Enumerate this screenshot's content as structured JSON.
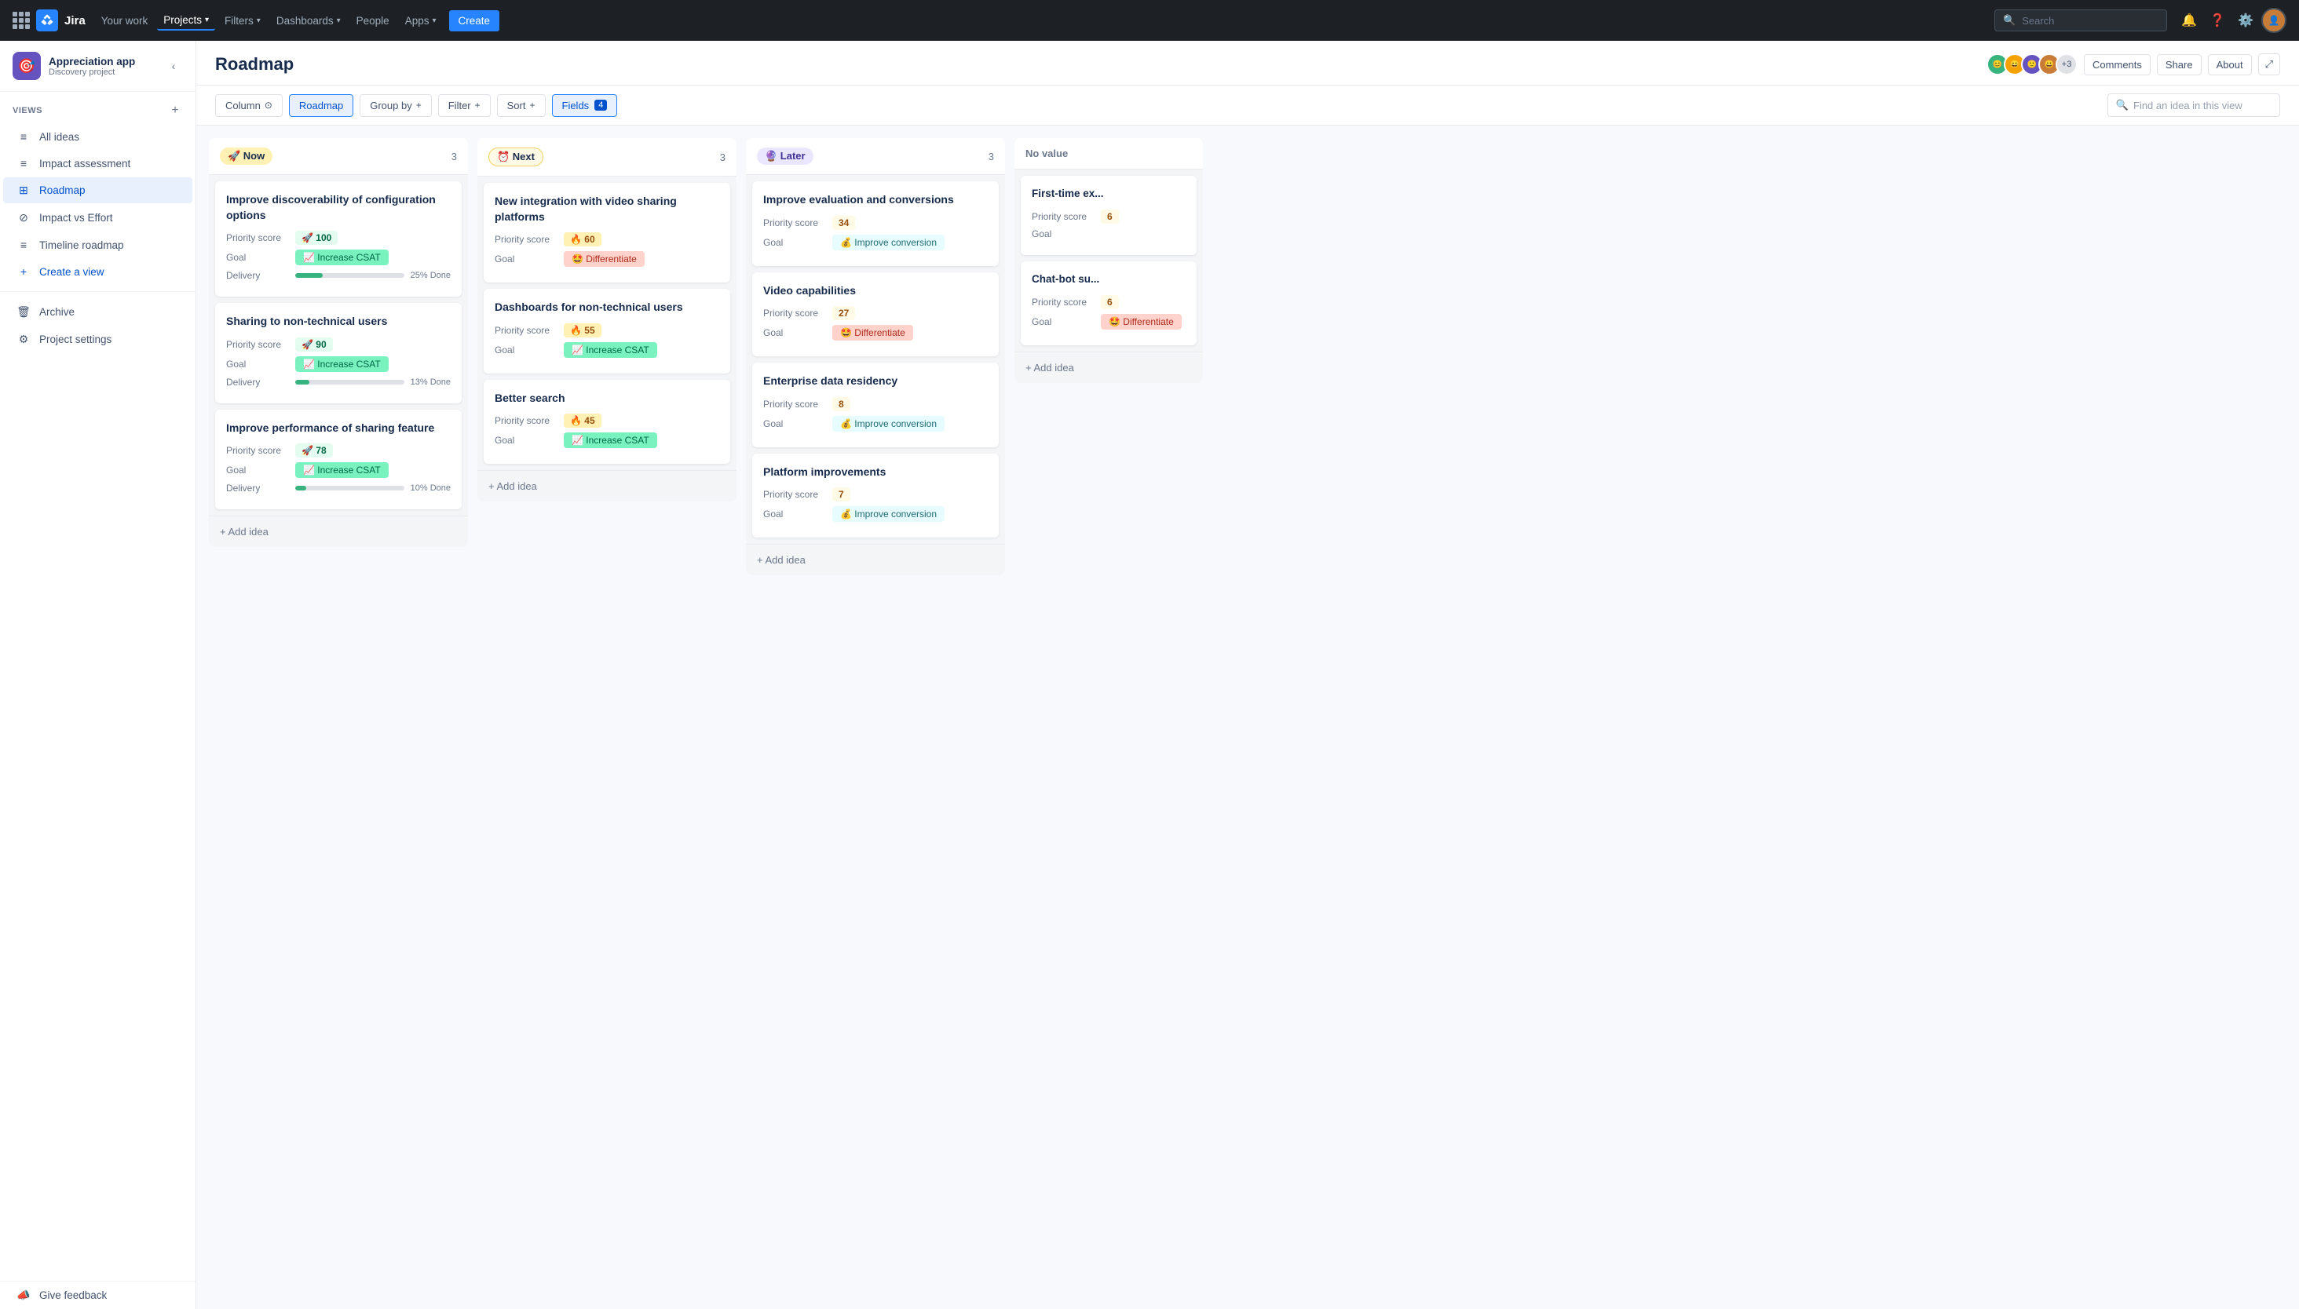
{
  "topnav": {
    "logo_text": "Jira",
    "your_work": "Your work",
    "projects": "Projects",
    "filters": "Filters",
    "dashboards": "Dashboards",
    "people": "People",
    "apps": "Apps",
    "create": "Create",
    "search_placeholder": "Search"
  },
  "sidebar": {
    "project_name": "Appreciation app",
    "project_type": "Discovery project",
    "project_emoji": "🎯",
    "views_label": "VIEWS",
    "items": [
      {
        "id": "all-ideas",
        "label": "All ideas",
        "icon": "≡"
      },
      {
        "id": "impact-assessment",
        "label": "Impact assessment",
        "icon": "≡"
      },
      {
        "id": "roadmap",
        "label": "Roadmap",
        "icon": "⊞",
        "active": true
      },
      {
        "id": "impact-vs-effort",
        "label": "Impact vs Effort",
        "icon": "⊘"
      },
      {
        "id": "timeline-roadmap",
        "label": "Timeline roadmap",
        "icon": "≡"
      },
      {
        "id": "create-view",
        "label": "Create a view",
        "icon": "+"
      }
    ],
    "archive": "Archive",
    "project_settings": "Project settings",
    "give_feedback": "Give feedback"
  },
  "page": {
    "title": "Roadmap",
    "header_btn_comments": "Comments",
    "header_btn_share": "Share",
    "header_btn_about": "About",
    "avatar_count": "+3"
  },
  "toolbar": {
    "column_label": "Column",
    "roadmap_label": "Roadmap",
    "group_by_label": "Group by",
    "filter_label": "Filter",
    "sort_label": "Sort",
    "fields_label": "Fields",
    "fields_count": "4",
    "search_placeholder": "Find an idea in this view"
  },
  "columns": [
    {
      "id": "now",
      "tag": "🚀 Now",
      "tag_class": "tag-now",
      "count": 3,
      "cards": [
        {
          "title": "Improve discoverability of configuration options",
          "priority_label": "Priority score",
          "priority_value": "100",
          "priority_emoji": "🚀",
          "priority_class": "score-green",
          "goal_label": "Goal",
          "goal_text": "Increase CSAT",
          "goal_emoji": "📈",
          "goal_class": "goal-csat",
          "has_delivery": true,
          "delivery_label": "Delivery",
          "delivery_pct": 25,
          "delivery_text": "25% Done"
        },
        {
          "title": "Sharing to non-technical users",
          "priority_label": "Priority score",
          "priority_value": "90",
          "priority_emoji": "🚀",
          "priority_class": "score-green",
          "goal_label": "Goal",
          "goal_text": "Increase CSAT",
          "goal_emoji": "📈",
          "goal_class": "goal-csat",
          "has_delivery": true,
          "delivery_label": "Delivery",
          "delivery_pct": 13,
          "delivery_text": "13% Done"
        },
        {
          "title": "Improve performance of sharing feature",
          "priority_label": "Priority score",
          "priority_value": "78",
          "priority_emoji": "🚀",
          "priority_class": "score-green",
          "goal_label": "Goal",
          "goal_text": "Increase CSAT",
          "goal_emoji": "📈",
          "goal_class": "goal-csat",
          "has_delivery": true,
          "delivery_label": "Delivery",
          "delivery_pct": 10,
          "delivery_text": "10% Done"
        }
      ],
      "add_idea": "+ Add idea"
    },
    {
      "id": "next",
      "tag": "⏰ Next",
      "tag_class": "tag-next",
      "count": 3,
      "cards": [
        {
          "title": "New integration with video sharing platforms",
          "priority_label": "Priority score",
          "priority_value": "60",
          "priority_emoji": "🔥",
          "priority_class": "score-orange",
          "goal_label": "Goal",
          "goal_text": "Differentiate",
          "goal_emoji": "🤩",
          "goal_class": "goal-differentiate",
          "has_delivery": false
        },
        {
          "title": "Dashboards for non-technical users",
          "priority_label": "Priority score",
          "priority_value": "55",
          "priority_emoji": "🔥",
          "priority_class": "score-orange",
          "goal_label": "Goal",
          "goal_text": "Increase CSAT",
          "goal_emoji": "📈",
          "goal_class": "goal-csat",
          "has_delivery": false
        },
        {
          "title": "Better search",
          "priority_label": "Priority score",
          "priority_value": "45",
          "priority_emoji": "🔥",
          "priority_class": "score-orange",
          "goal_label": "Goal",
          "goal_text": "Increase CSAT",
          "goal_emoji": "📈",
          "goal_class": "goal-csat",
          "has_delivery": false
        }
      ],
      "add_idea": "+ Add idea"
    },
    {
      "id": "later",
      "tag": "🔮 Later",
      "tag_class": "tag-later",
      "count": 3,
      "cards": [
        {
          "title": "Improve evaluation and conversions",
          "priority_label": "Priority score",
          "priority_value": "34",
          "priority_emoji": "",
          "priority_class": "score-yellow",
          "goal_label": "Goal",
          "goal_text": "Improve conversion",
          "goal_emoji": "💰",
          "goal_class": "goal-conversion",
          "has_delivery": false
        },
        {
          "title": "Video capabilities",
          "priority_label": "Priority score",
          "priority_value": "27",
          "priority_emoji": "",
          "priority_class": "score-yellow",
          "goal_label": "Goal",
          "goal_text": "Differentiate",
          "goal_emoji": "🤩",
          "goal_class": "goal-differentiate",
          "has_delivery": false
        },
        {
          "title": "Enterprise data residency",
          "priority_label": "Priority score",
          "priority_value": "8",
          "priority_emoji": "",
          "priority_class": "score-yellow",
          "goal_label": "Goal",
          "goal_text": "Improve conversion",
          "goal_emoji": "💰",
          "goal_class": "goal-conversion",
          "has_delivery": false
        },
        {
          "title": "Platform improvements",
          "priority_label": "Priority score",
          "priority_value": "7",
          "priority_emoji": "",
          "priority_class": "score-yellow",
          "goal_label": "Goal",
          "goal_text": "Improve conversion",
          "goal_emoji": "💰",
          "goal_class": "goal-conversion",
          "has_delivery": false
        }
      ],
      "add_idea": "+ Add idea"
    },
    {
      "id": "no-value",
      "tag": "No value",
      "tag_class": "tag-novalue",
      "count": null,
      "cards": [
        {
          "title": "First-time ex...",
          "priority_label": "Priority score",
          "priority_value": "6",
          "priority_emoji": "",
          "priority_class": "score-yellow",
          "goal_label": "Goal",
          "goal_text": "",
          "goal_emoji": "",
          "goal_class": "",
          "has_delivery": false
        },
        {
          "title": "Chat-bot su...",
          "priority_label": "Priority score",
          "priority_value": "6",
          "priority_emoji": "",
          "priority_class": "score-yellow",
          "goal_label": "Goal",
          "goal_text": "Differentiate",
          "goal_emoji": "🤩",
          "goal_class": "goal-differentiate",
          "has_delivery": false
        }
      ],
      "add_idea": "+ Add idea"
    }
  ]
}
